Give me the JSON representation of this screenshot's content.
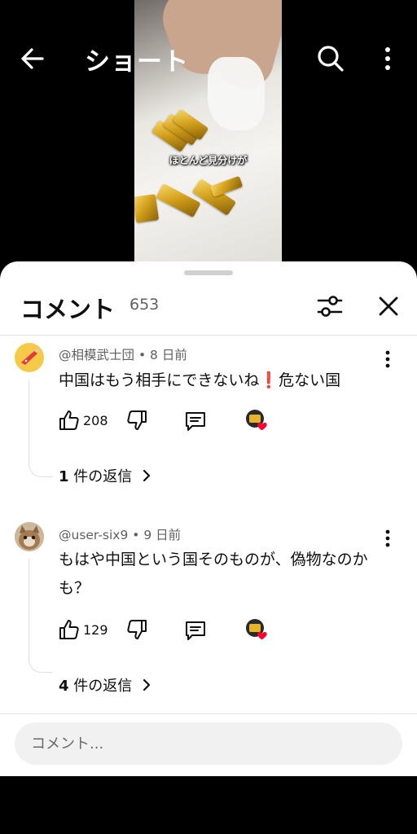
{
  "topbar": {
    "title": "ショート"
  },
  "video": {
    "subtitle": "ほとんど見分けが"
  },
  "comments_panel": {
    "title": "コメント",
    "count": "653",
    "comments": [
      {
        "author": "@相模武士団",
        "age": "8 日前",
        "text": "中国はもう相手にできないね❗危ない国",
        "likes": "208",
        "replies_count": "1",
        "replies_suffix": " 件の返信"
      },
      {
        "author": "@user-six9",
        "age": "9 日前",
        "text": "もはや中国という国そのものが、偽物なのかも？",
        "likes": "129",
        "replies_count": "4",
        "replies_suffix": " 件の返信"
      }
    ]
  },
  "input": {
    "placeholder": "コメント..."
  },
  "colors": {
    "heart": "#ff0033",
    "text": "#0f0f0f",
    "muted": "#606060"
  }
}
